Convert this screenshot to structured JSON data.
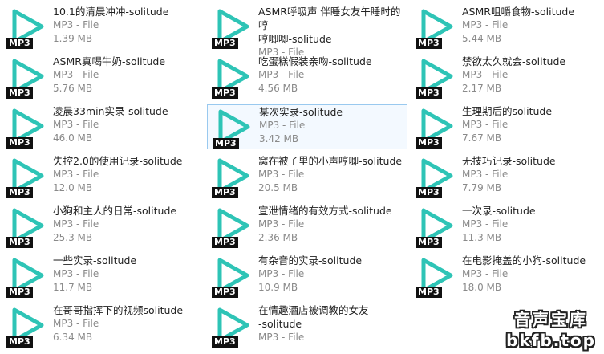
{
  "files": [
    {
      "name": "10.1的清晨冲冲-solitude",
      "type": "MP3 - File",
      "size": "1.39 MB",
      "badge": "MP3"
    },
    {
      "name": "ASMR呼吸声 伴睡女友午睡时的哼\n哼唧唧-solitude",
      "type": "MP3 - File",
      "size": "",
      "badge": "MP3"
    },
    {
      "name": "ASMR咀嚼食物-solitude",
      "type": "MP3 - File",
      "size": "5.44 MB",
      "badge": "MP3"
    },
    {
      "name": "ASMR真喝牛奶-solitude",
      "type": "MP3 - File",
      "size": "5.76 MB",
      "badge": "MP3"
    },
    {
      "name": "吃蛋糕假装亲吻-solitude",
      "type": "MP3 - File",
      "size": "4.56 MB",
      "badge": "MP3"
    },
    {
      "name": "禁欲太久就会-solitude",
      "type": "MP3 - File",
      "size": "2.17 MB",
      "badge": "MP3"
    },
    {
      "name": "凌晨33min实录-solitude",
      "type": "MP3 - File",
      "size": "46.0 MB",
      "badge": "MP3"
    },
    {
      "name": "某次实录-solitude",
      "type": "MP3 - File",
      "size": "3.42 MB",
      "badge": "MP3"
    },
    {
      "name": "生理期后的solitude",
      "type": "MP3 - File",
      "size": "7.67 MB",
      "badge": "MP3"
    },
    {
      "name": "失控2.0的使用记录-solitude",
      "type": "MP3 - File",
      "size": "12.0 MB",
      "badge": "MP3"
    },
    {
      "name": "窝在被子里的小声哼唧-solitude",
      "type": "MP3 - File",
      "size": "20.5 MB",
      "badge": "MP3"
    },
    {
      "name": "无技巧记录-solitude",
      "type": "MP3 - File",
      "size": "7.79 MB",
      "badge": "MP3"
    },
    {
      "name": "小狗和主人的日常-solitude",
      "type": "MP3 - File",
      "size": "25.3 MB",
      "badge": "MP3"
    },
    {
      "name": "宣泄情绪的有效方式-solitude",
      "type": "MP3 - File",
      "size": "2.36 MB",
      "badge": "MP3"
    },
    {
      "name": "一次录-solitude",
      "type": "MP3 - File",
      "size": "11.3 MB",
      "badge": "MP3"
    },
    {
      "name": "一些实录-solitude",
      "type": "MP3 - File",
      "size": "11.7 MB",
      "badge": "MP3"
    },
    {
      "name": "有杂音的实录-solitude",
      "type": "MP3 - File",
      "size": "10.9 MB",
      "badge": "MP3"
    },
    {
      "name": "在电影掩盖的小狗-solitude",
      "type": "MP3 - File",
      "size": "18.0 MB",
      "badge": "MP3"
    },
    {
      "name": "在哥哥指挥下的视频solitude",
      "type": "MP3 - File",
      "size": "6.34 MB",
      "badge": "MP3"
    },
    {
      "name": "在情趣酒店被调教的女友\n-solitude",
      "type": "MP3 - File",
      "size": "",
      "badge": "MP3"
    }
  ],
  "watermark": {
    "line1": "音声宝库",
    "line2": "bkfb.top"
  },
  "colors": {
    "play_icon": "#2ec4b6",
    "selection_border": "#99c9ef",
    "selection_bg": "#f3f9ff"
  },
  "selected_index": 7
}
